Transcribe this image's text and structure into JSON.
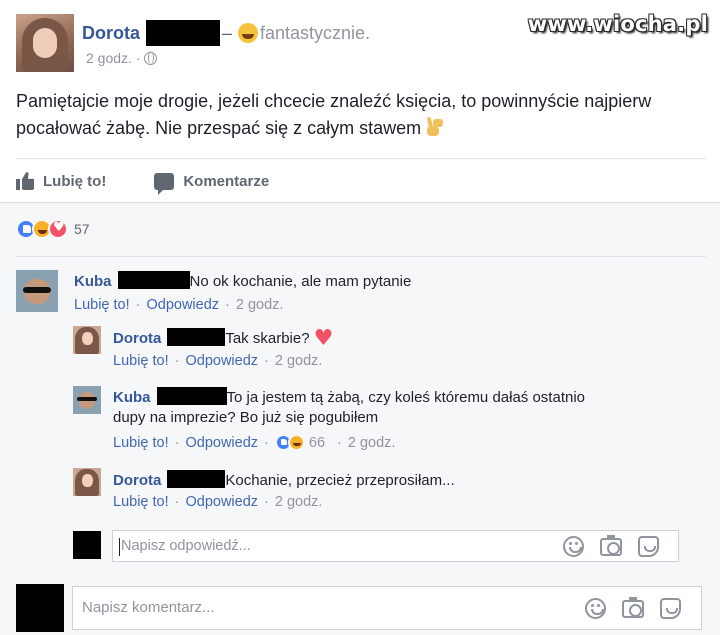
{
  "watermark": "www.wiocha.pl",
  "post": {
    "author": "Dorota",
    "separator": "–",
    "feeling": "fantastycznie.",
    "time": "2 godz. ·",
    "text": "Pamiętajcie moje drogie, jeżeli chcecie znaleźć księcia, to powinnyście najpierw pocałować żabę. Nie przespać się z całym stawem"
  },
  "actions": {
    "like": "Lubię to!",
    "comment": "Komentarze"
  },
  "reactions": {
    "count": "57",
    "types": [
      "like",
      "haha",
      "love"
    ],
    "colors": {
      "like": "#4080ff",
      "haha": "#f7b125",
      "love": "#f25268"
    }
  },
  "comments": [
    {
      "author": "Kuba",
      "text": "No ok kochanie, ale mam pytanie",
      "like": "Lubię to!",
      "reply": "Odpowiedz",
      "time": "2 godz."
    },
    {
      "author": "Dorota",
      "text": "Tak skarbie?",
      "like": "Lubię to!",
      "reply": "Odpowiedz",
      "time": "2 godz."
    },
    {
      "author": "Kuba",
      "text_line1": "To ja jestem tą żabą, czy koleś któremu dałaś ostatnio",
      "text_line2": "dupy na imprezie? Bo już się pogubiłem",
      "like": "Lubię to!",
      "reply": "Odpowiedz",
      "reaction_count": "66",
      "time": "2 godz."
    },
    {
      "author": "Dorota",
      "text": "Kochanie, przecież przeprosiłam...",
      "like": "Lubię to!",
      "reply": "Odpowiedz",
      "time": "2 godz."
    }
  ],
  "reply_box": {
    "placeholder": "Napisz odpowiedź..."
  },
  "comment_box": {
    "placeholder": "Napisz komentarz..."
  },
  "colors": {
    "link": "#365899",
    "meta": "#90949c",
    "redaction": "#000000"
  }
}
